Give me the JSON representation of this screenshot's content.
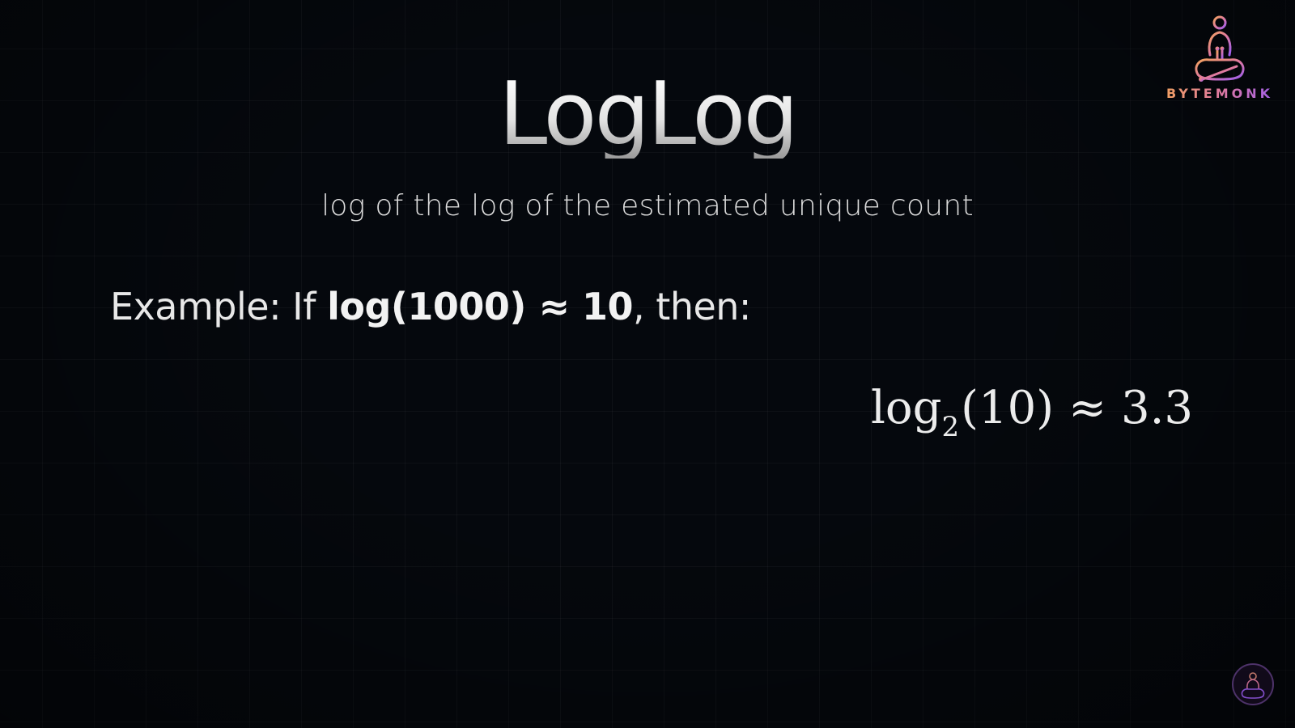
{
  "slide": {
    "title": "LogLog",
    "subtitle": "log of the log of the estimated unique count",
    "example": {
      "prefix": "Example: If ",
      "expression": "log(1000) ≈ 10",
      "suffix": ", then:"
    },
    "formula": {
      "func": "log",
      "base": "2",
      "argument": "(10)",
      "relation": "≈",
      "result": "3.3"
    }
  },
  "brand": {
    "name": "BYTEMONK",
    "icon": "monk-logo-icon",
    "colors": [
      "#f2a35c",
      "#e07aa0",
      "#9b5cf0"
    ]
  },
  "watermark": {
    "icon": "channel-avatar-icon"
  },
  "colors": {
    "background": "#05080d",
    "text": "#e8e8e8"
  }
}
